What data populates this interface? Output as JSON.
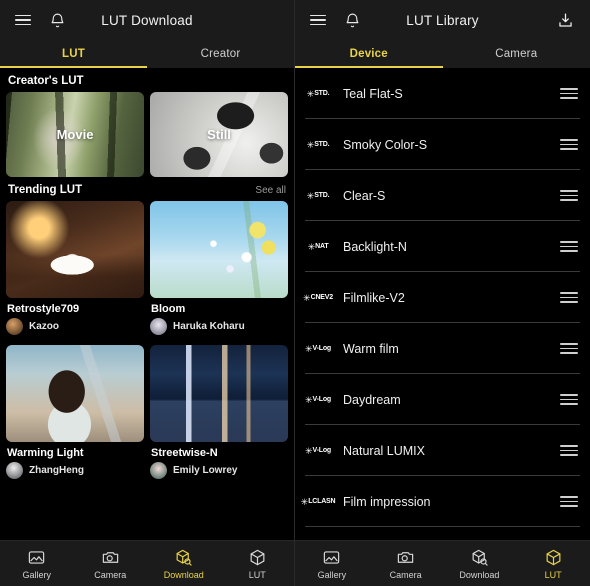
{
  "accent_color": "#E8D24A",
  "left_panel": {
    "header": {
      "menu_icon": "hamburger-icon",
      "bell_icon": "bell-icon",
      "title": "LUT Download"
    },
    "tabs": [
      {
        "label": "LUT",
        "active": true
      },
      {
        "label": "Creator",
        "active": false
      }
    ],
    "creators_section": {
      "title": "Creator's LUT",
      "cards": [
        {
          "label": "Movie"
        },
        {
          "label": "Still"
        }
      ]
    },
    "trending_section": {
      "title": "Trending LUT",
      "see_all": "See all",
      "cards": [
        {
          "name": "Retrostyle709",
          "author": "Kazoo"
        },
        {
          "name": "Bloom",
          "author": "Haruka Koharu"
        },
        {
          "name": "Warming Light",
          "author": "ZhangHeng"
        },
        {
          "name": "Streetwise-N",
          "author": "Emily Lowrey"
        }
      ]
    },
    "bottom_nav": [
      {
        "label": "Gallery",
        "icon": "gallery-icon",
        "active": false
      },
      {
        "label": "Camera",
        "icon": "camera-icon",
        "active": false
      },
      {
        "label": "Download",
        "icon": "download-cube-icon",
        "active": true
      },
      {
        "label": "LUT",
        "icon": "cube-icon",
        "active": false
      }
    ]
  },
  "right_panel": {
    "header": {
      "menu_icon": "hamburger-icon",
      "bell_icon": "bell-icon",
      "title": "LUT Library",
      "download_icon": "download-icon"
    },
    "tabs": [
      {
        "label": "Device",
        "active": true
      },
      {
        "label": "Camera",
        "active": false
      }
    ],
    "lut_items": [
      {
        "badge": "STD.",
        "name": "Teal Flat-S"
      },
      {
        "badge": "STD.",
        "name": "Smoky Color-S"
      },
      {
        "badge": "STD.",
        "name": "Clear-S"
      },
      {
        "badge": "NAT",
        "name": "Backlight-N"
      },
      {
        "badge": "CNEV2",
        "name": "Filmlike-V2"
      },
      {
        "badge": "V-Log",
        "name": "Warm film"
      },
      {
        "badge": "V-Log",
        "name": "Daydream"
      },
      {
        "badge": "V-Log",
        "name": "Natural LUMIX"
      },
      {
        "badge": "LCLASN",
        "name": "Film impression"
      }
    ],
    "bottom_nav": [
      {
        "label": "Gallery",
        "icon": "gallery-icon",
        "active": false
      },
      {
        "label": "Camera",
        "icon": "camera-icon",
        "active": false
      },
      {
        "label": "Download",
        "icon": "download-cube-icon",
        "active": false
      },
      {
        "label": "LUT",
        "icon": "cube-icon",
        "active": true
      }
    ]
  }
}
